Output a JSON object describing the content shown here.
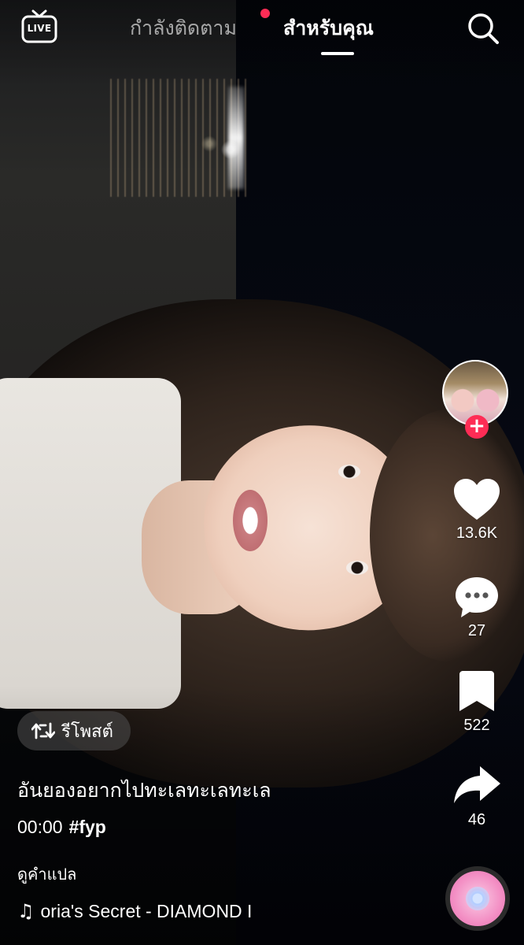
{
  "top_nav": {
    "live_label": "LIVE",
    "tabs": [
      {
        "label": "กำลังติดตาม",
        "active": false,
        "has_dot": true
      },
      {
        "label": "สำหรับคุณ",
        "active": true,
        "has_dot": false
      }
    ],
    "search_icon": "search-icon"
  },
  "actions": {
    "follow_icon": "plus-icon",
    "like": {
      "icon": "heart-icon",
      "count": "13.6K"
    },
    "comment": {
      "icon": "comment-bubble-icon",
      "count": "27"
    },
    "save": {
      "icon": "bookmark-icon",
      "count": "522"
    },
    "share": {
      "icon": "share-arrow-icon",
      "count": "46"
    }
  },
  "post": {
    "repost_label": "รีโพสต์",
    "caption": "อันยองอยากไปทะเลทะเลทะเล",
    "timestamp": "00:00",
    "hashtag": "#fyp",
    "translate_label": "ดูคำแปล",
    "music_title": "oria's Secret - DIAMOND I"
  },
  "colors": {
    "accent_red": "#fe2c55",
    "text_primary": "#ffffff",
    "chip_bg": "rgba(80,80,80,0.55)"
  }
}
